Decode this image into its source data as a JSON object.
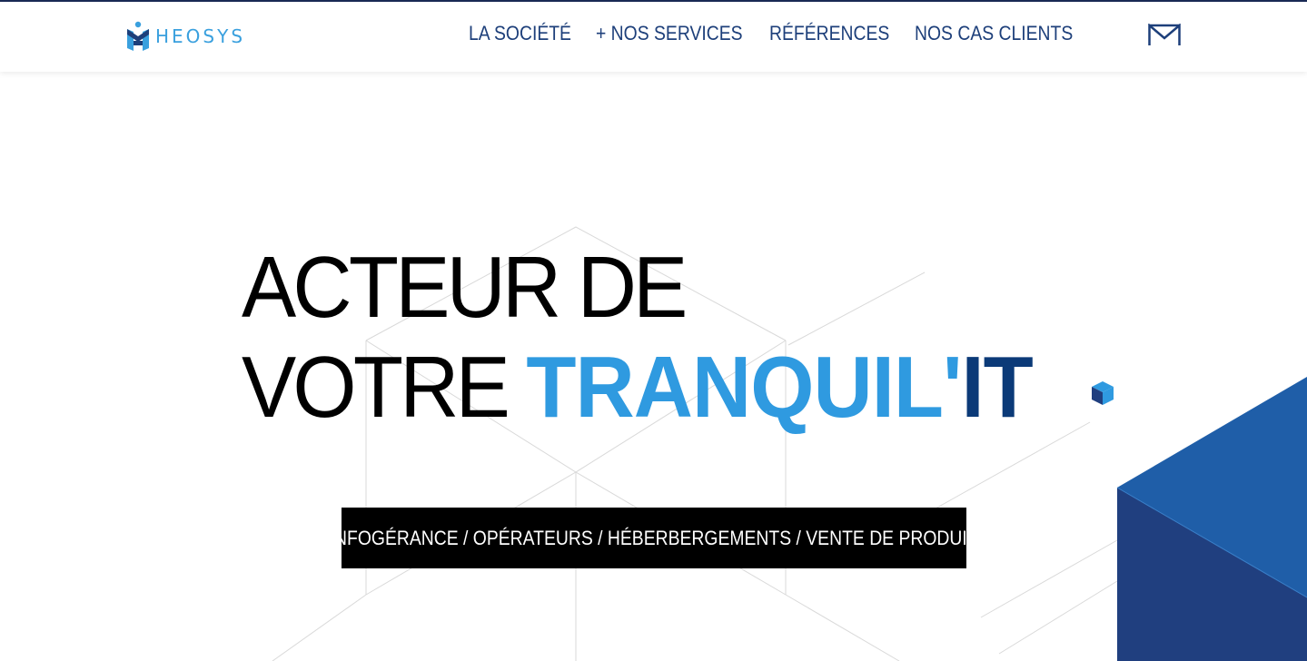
{
  "header": {
    "logo_text": "HEOSYS",
    "nav": [
      {
        "label": "LA SOCIÉTÉ"
      },
      {
        "label": "+ NOS SERVICES"
      },
      {
        "label": "RÉFÉRENCES"
      },
      {
        "label": "NOS CAS CLIENTS"
      }
    ],
    "mail_icon": "mail-icon"
  },
  "hero": {
    "line1": "ACTEUR DE",
    "line2_prefix": "VOTRE",
    "line2_accent_light": "TRANQUIL'",
    "line2_accent_dark": "IT",
    "services": "INFOGÉRANCE / OPÉRATEURS / HÉBERBERGEMENTS / VENTE DE PRODUIT"
  },
  "colors": {
    "navy": "#1d3f7a",
    "brand_light_blue": "#2f9ae0",
    "brand_dark_blue": "#0b3a78",
    "cube_blue": "#1f5ea8",
    "cube_dark": "#203f7f"
  }
}
